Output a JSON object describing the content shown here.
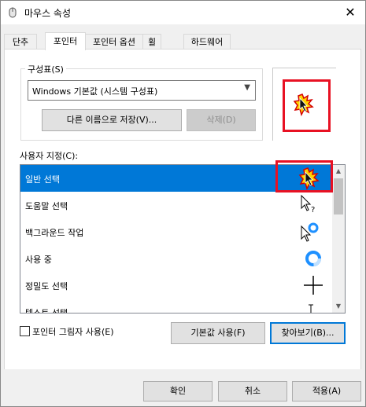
{
  "window": {
    "title": "마우스 속성",
    "close_glyph": "✕"
  },
  "tabs": [
    {
      "label": "단추"
    },
    {
      "label": "포인터"
    },
    {
      "label": "포인터 옵션"
    },
    {
      "label": "휠"
    },
    {
      "label": "하드웨어"
    }
  ],
  "scheme": {
    "label": "구성표(S)",
    "value": "Windows 기본값 (시스템 구성표)",
    "save_as_label": "다른 이름으로 저장(V)...",
    "delete_label": "삭제(D)"
  },
  "customize": {
    "label": "사용자 지정(C):",
    "items": [
      {
        "label": "일반 선택",
        "icon": "flame-arrow-cursor-icon"
      },
      {
        "label": "도움말 선택",
        "icon": "help-cursor-icon"
      },
      {
        "label": "백그라운드 작업",
        "icon": "working-cursor-icon"
      },
      {
        "label": "사용 중",
        "icon": "busy-cursor-icon"
      },
      {
        "label": "정밀도 선택",
        "icon": "crosshair-cursor-icon"
      },
      {
        "label": "텍스트 선택",
        "icon": "text-cursor-icon"
      }
    ]
  },
  "options": {
    "shadow_label": "포인터 그림자 사용(E)",
    "default_label": "기본값 사용(F)",
    "browse_label": "찾아보기(B)..."
  },
  "dialog": {
    "ok": "확인",
    "cancel": "취소",
    "apply": "적용(A)"
  },
  "colors": {
    "accent": "#0078d7",
    "highlight": "#e81123"
  }
}
